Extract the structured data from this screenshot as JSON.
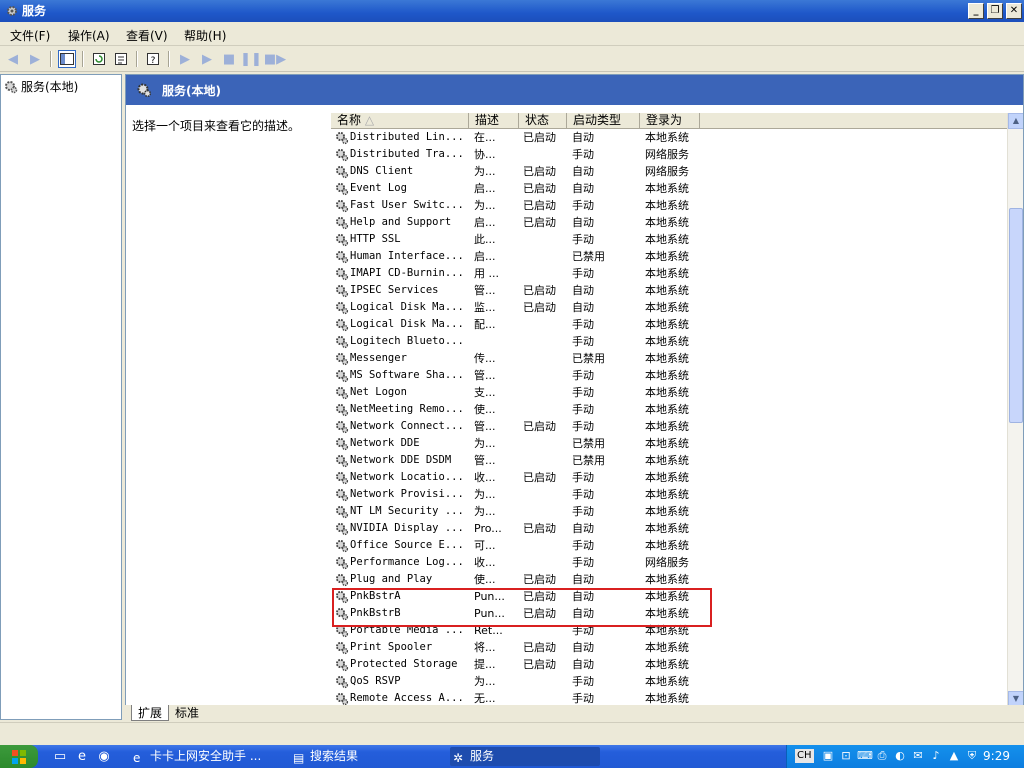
{
  "window": {
    "title": "服务",
    "min": "_",
    "max": "❐",
    "close": "✕"
  },
  "menu": [
    {
      "label": "文件(F)"
    },
    {
      "label": "操作(A)"
    },
    {
      "label": "查看(V)"
    },
    {
      "label": "帮助(H)"
    }
  ],
  "tree": {
    "item": "服务(本地)"
  },
  "panel": {
    "header": "服务(本地)",
    "description": "选择一个项目来查看它的描述。"
  },
  "columns": [
    "名称",
    "描述",
    "状态",
    "启动类型",
    "登录为"
  ],
  "rows": [
    {
      "name": "Distributed Lin...",
      "desc": "在...",
      "status": "已启动",
      "startup": "自动",
      "logon": "本地系统"
    },
    {
      "name": "Distributed Tra...",
      "desc": "协...",
      "status": "",
      "startup": "手动",
      "logon": "网络服务"
    },
    {
      "name": "DNS Client",
      "desc": "为...",
      "status": "已启动",
      "startup": "自动",
      "logon": "网络服务"
    },
    {
      "name": "Event Log",
      "desc": "启...",
      "status": "已启动",
      "startup": "自动",
      "logon": "本地系统"
    },
    {
      "name": "Fast User Switc...",
      "desc": "为...",
      "status": "已启动",
      "startup": "手动",
      "logon": "本地系统"
    },
    {
      "name": "Help and Support",
      "desc": "启...",
      "status": "已启动",
      "startup": "自动",
      "logon": "本地系统"
    },
    {
      "name": "HTTP SSL",
      "desc": "此...",
      "status": "",
      "startup": "手动",
      "logon": "本地系统"
    },
    {
      "name": "Human Interface...",
      "desc": "启...",
      "status": "",
      "startup": "已禁用",
      "logon": "本地系统"
    },
    {
      "name": "IMAPI CD-Burnin...",
      "desc": "用 ...",
      "status": "",
      "startup": "手动",
      "logon": "本地系统"
    },
    {
      "name": "IPSEC Services",
      "desc": "管...",
      "status": "已启动",
      "startup": "自动",
      "logon": "本地系统"
    },
    {
      "name": "Logical Disk Ma...",
      "desc": "监...",
      "status": "已启动",
      "startup": "自动",
      "logon": "本地系统"
    },
    {
      "name": "Logical Disk Ma...",
      "desc": "配...",
      "status": "",
      "startup": "手动",
      "logon": "本地系统"
    },
    {
      "name": "Logitech Blueto...",
      "desc": "",
      "status": "",
      "startup": "手动",
      "logon": "本地系统"
    },
    {
      "name": "Messenger",
      "desc": "传...",
      "status": "",
      "startup": "已禁用",
      "logon": "本地系统"
    },
    {
      "name": "MS Software Sha...",
      "desc": "管...",
      "status": "",
      "startup": "手动",
      "logon": "本地系统"
    },
    {
      "name": "Net Logon",
      "desc": "支...",
      "status": "",
      "startup": "手动",
      "logon": "本地系统"
    },
    {
      "name": "NetMeeting Remo...",
      "desc": "使...",
      "status": "",
      "startup": "手动",
      "logon": "本地系统"
    },
    {
      "name": "Network Connect...",
      "desc": "管...",
      "status": "已启动",
      "startup": "手动",
      "logon": "本地系统"
    },
    {
      "name": "Network DDE",
      "desc": "为...",
      "status": "",
      "startup": "已禁用",
      "logon": "本地系统"
    },
    {
      "name": "Network DDE DSDM",
      "desc": "管...",
      "status": "",
      "startup": "已禁用",
      "logon": "本地系统"
    },
    {
      "name": "Network Locatio...",
      "desc": "收...",
      "status": "已启动",
      "startup": "手动",
      "logon": "本地系统"
    },
    {
      "name": "Network Provisi...",
      "desc": "为...",
      "status": "",
      "startup": "手动",
      "logon": "本地系统"
    },
    {
      "name": "NT LM Security ...",
      "desc": "为...",
      "status": "",
      "startup": "手动",
      "logon": "本地系统"
    },
    {
      "name": "NVIDIA Display ...",
      "desc": "Pro...",
      "status": "已启动",
      "startup": "自动",
      "logon": "本地系统"
    },
    {
      "name": "Office Source E...",
      "desc": "可...",
      "status": "",
      "startup": "手动",
      "logon": "本地系统"
    },
    {
      "name": "Performance Log...",
      "desc": "收...",
      "status": "",
      "startup": "手动",
      "logon": "网络服务"
    },
    {
      "name": "Plug and Play",
      "desc": "使...",
      "status": "已启动",
      "startup": "自动",
      "logon": "本地系统"
    },
    {
      "name": "PnkBstrA",
      "desc": "Pun...",
      "status": "已启动",
      "startup": "自动",
      "logon": "本地系统"
    },
    {
      "name": "PnkBstrB",
      "desc": "Pun...",
      "status": "已启动",
      "startup": "自动",
      "logon": "本地系统"
    },
    {
      "name": "Portable Media ...",
      "desc": "Ret...",
      "status": "",
      "startup": "手动",
      "logon": "本地系统"
    },
    {
      "name": "Print Spooler",
      "desc": "将...",
      "status": "已启动",
      "startup": "自动",
      "logon": "本地系统"
    },
    {
      "name": "Protected Storage",
      "desc": "提...",
      "status": "已启动",
      "startup": "自动",
      "logon": "本地系统"
    },
    {
      "name": "QoS RSVP",
      "desc": "为...",
      "status": "",
      "startup": "手动",
      "logon": "本地系统"
    },
    {
      "name": "Remote Access A...",
      "desc": "无...",
      "status": "",
      "startup": "手动",
      "logon": "本地系统"
    }
  ],
  "tabs": {
    "extended": "扩展",
    "standard": "标准"
  },
  "taskbar": {
    "tasks": [
      "卡卡上网安全助手 ...",
      "搜索结果",
      "服务"
    ],
    "lang": "CH",
    "clock": "9:29"
  },
  "colors": {
    "titlebar": "#1e57c9",
    "panel_header": "#3b64b8",
    "highlight_box": "#d92020",
    "taskbar": "#245edb"
  },
  "icons": {
    "service": "gear-icon",
    "back": "arrow-left-icon",
    "forward": "arrow-right-icon",
    "play": "play-icon",
    "stop": "stop-icon",
    "pause": "pause-icon",
    "restart": "restart-icon"
  }
}
